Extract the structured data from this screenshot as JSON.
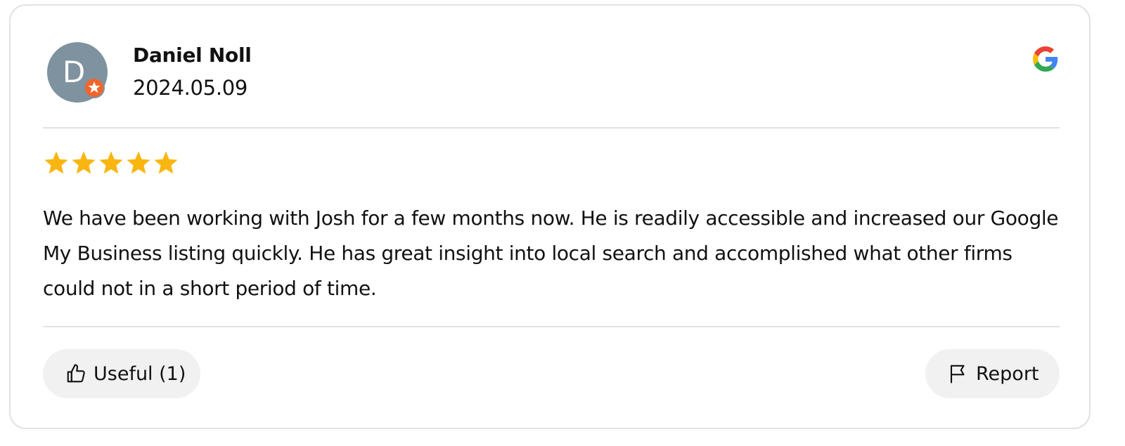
{
  "review": {
    "reviewer_name": "Daniel Noll",
    "reviewer_initial": "D",
    "date": "2024.05.09",
    "source": "google-icon",
    "rating": 5,
    "rating_max": 5,
    "text": "We have been working with Josh for a few months now. He is readily accessible and increased our Google My Business listing quickly. He has great insight into local search and accomplished what other firms could not in a short period of time."
  },
  "actions": {
    "useful_label": "Useful (1)",
    "report_label": "Report"
  },
  "colors": {
    "avatar_bg": "#7e929f",
    "badge": "#f0662a",
    "star": "#f9b611",
    "pill_bg": "#f1f1f1",
    "border": "#e2e2e2"
  }
}
